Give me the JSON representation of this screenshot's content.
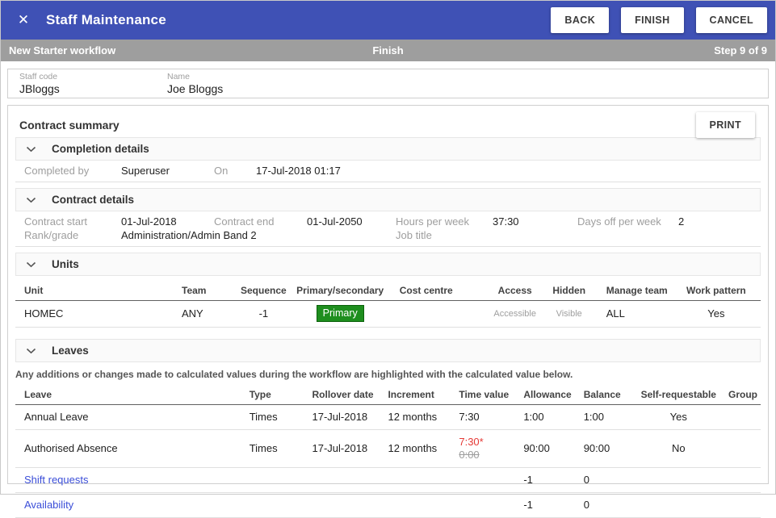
{
  "colors": {
    "appbar_blue": "#3f51b5",
    "workflow_bar_gray": "#9e9e9e",
    "badge_green": "#1e8e1e",
    "changed_value_red": "#e53935",
    "link_blue": "#3b4ed8"
  },
  "appbar": {
    "title": "Staff Maintenance",
    "close_icon": "✕",
    "back_label": "BACK",
    "finish_label": "FINISH",
    "cancel_label": "CANCEL"
  },
  "workflow_bar": {
    "name": "New Starter workflow",
    "current_step": "Finish",
    "progress": "Step 9 of 9"
  },
  "staff": {
    "staff_code_label": "Staff code",
    "staff_code": "JBloggs",
    "name_label": "Name",
    "name": "Joe Bloggs"
  },
  "summary": {
    "title": "Contract summary",
    "print_label": "PRINT"
  },
  "sections": {
    "completion": {
      "title": "Completion details",
      "completed_by_label": "Completed by",
      "completed_by": "Superuser",
      "on_label": "On",
      "completed_on": "17-Jul-2018 01:17"
    },
    "contract": {
      "title": "Contract details",
      "contract_start_label": "Contract start",
      "contract_start": "01-Jul-2018",
      "contract_end_label": "Contract end",
      "contract_end": "01-Jul-2050",
      "hours_per_week_label": "Hours per week",
      "hours_per_week": "37:30",
      "days_off_label": "Days off per week",
      "days_off": "2",
      "rank_grade_label": "Rank/grade",
      "rank_grade": "Administration/Admin Band 2",
      "job_title_label": "Job title",
      "job_title": ""
    },
    "units": {
      "title": "Units",
      "columns": [
        "Unit",
        "Team",
        "Sequence",
        "Primary/secondary",
        "Cost centre",
        "Access",
        "Hidden",
        "Manage team",
        "Work pattern"
      ],
      "rows": [
        {
          "unit": "HOMEC",
          "team": "ANY",
          "sequence": "-1",
          "primary_secondary": "Primary",
          "cost_centre": "",
          "access": "Accessible",
          "hidden": "Visible",
          "manage_team": "ALL",
          "work_pattern": "Yes"
        }
      ]
    },
    "leaves": {
      "title": "Leaves",
      "note": "Any additions or changes made to calculated values during the workflow are highlighted with the calculated value below.",
      "columns": [
        "Leave",
        "Type",
        "Rollover date",
        "Increment",
        "Time value",
        "Allowance",
        "Balance",
        "Self-requestable",
        "Group"
      ],
      "rows": [
        {
          "leave": "Annual Leave",
          "type": "Times",
          "rollover_date": "17-Jul-2018",
          "increment": "12 months",
          "time_value": "7:30",
          "time_value_old": "",
          "allowance": "1:00",
          "balance": "1:00",
          "self_requestable": "Yes",
          "group": ""
        },
        {
          "leave": "Authorised Absence",
          "type": "Times",
          "rollover_date": "17-Jul-2018",
          "increment": "12 months",
          "time_value": "7:30*",
          "time_value_old": "0:00",
          "allowance": "90:00",
          "balance": "90:00",
          "self_requestable": "No",
          "group": ""
        },
        {
          "leave": "Shift requests",
          "type": "",
          "rollover_date": "",
          "increment": "",
          "time_value": "",
          "time_value_old": "",
          "allowance": "-1",
          "balance": "0",
          "self_requestable": "",
          "group": ""
        },
        {
          "leave": "Availability",
          "type": "",
          "rollover_date": "",
          "increment": "",
          "time_value": "",
          "time_value_old": "",
          "allowance": "-1",
          "balance": "0",
          "self_requestable": "",
          "group": ""
        }
      ]
    }
  }
}
